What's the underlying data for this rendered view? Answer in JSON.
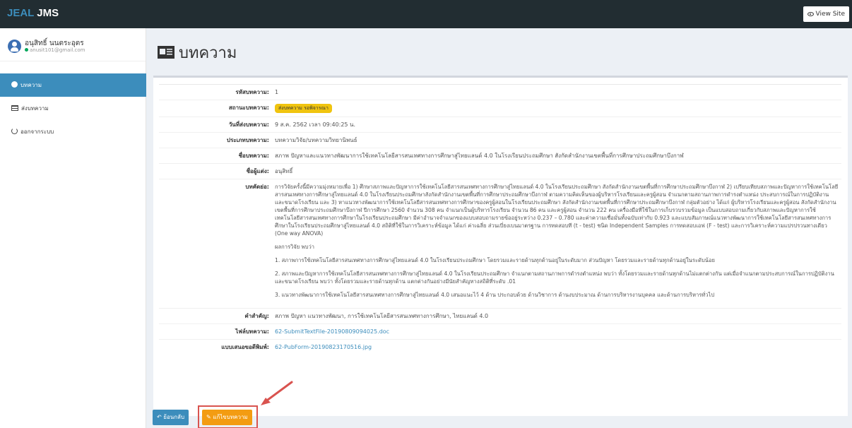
{
  "topbar": {
    "brand_accent": "JEAL",
    "brand_rest": " JMS",
    "view_site": "View Site"
  },
  "user": {
    "name": "อนุสิทธิ์ นนตระอุตร",
    "email": "anusit101@gmail.com"
  },
  "nav": {
    "items": [
      {
        "label": "บทความ",
        "active": true
      },
      {
        "label": "ส่งบทความ",
        "active": false
      },
      {
        "label": "ออกจากระบบ",
        "active": false
      }
    ]
  },
  "page": {
    "title": "บทความ"
  },
  "article": {
    "rows": [
      {
        "label": "รหัสบทความ:",
        "value": "1"
      },
      {
        "label": "สถานะบทความ:",
        "value": "ส่งบทความ รอพิจารณา"
      },
      {
        "label": "วันที่ส่งบทความ:",
        "value": "9 ส.ค. 2562 เวลา 09:40:25 น."
      },
      {
        "label": "ประเภทบทความ:",
        "value": "บทความวิจัย/บทความวิทยานิพนธ์"
      },
      {
        "label": "ชื่อบทความ:",
        "value": "สภาพ ปัญหาและแนวทางพัฒนาการใช้เทคโนโลยีสารสนเทศทางการศึกษาสู่ไทยแลนด์ 4.0 ในโรงเรียนประถมศึกษา สังกัดสำนักงานเขตพื้นที่การศึกษาประถมศึกษาบึงกาฬ"
      },
      {
        "label": "ชื่อผู้แต่ง:",
        "value": "อนุสิทธิ์"
      },
      {
        "label": "บทคัดย่อ:",
        "value": ""
      },
      {
        "label": "คำสำคัญ:",
        "value": "สภาพ ปัญหา แนวทางพัฒนา, การใช้เทคโนโลยีสารสนเทศทางการศึกษา, ไทยแลนด์ 4.0"
      },
      {
        "label": "ไฟล์บทความ:",
        "value": "62-SubmitTextFile-20190809094025.doc"
      },
      {
        "label": "แบบเสนอขอตีพิมพ์:",
        "value": "62-PubForm-20190823170516.jpg"
      }
    ],
    "abstract": [
      "การวิจัยครั้งนี้มีความมุ่งหมายเพื่อ 1) ศึกษาสภาพและปัญหาการใช้เทคโนโลยีสารสนเทศทางการศึกษาสู่ไทยแลนด์ 4.0 ในโรงเรียนประถมศึกษา สังกัดสำนักงานเขตพื้นที่การศึกษาประถมศึกษาบึงกาฬ 2) เปรียบเทียบสภาพและปัญหาการใช้เทคโนโลยีสารสนเทศทางการศึกษาสู่ไทยแลนด์ 4.0 ในโรงเรียนประถมศึกษาสังกัดสำนักงานเขตพื้นที่การศึกษาประถมศึกษาบึงกาฬ ตามความคิดเห็นของผู้บริหารโรงเรียนและครูผู้สอน จำแนกตามสถานภาพการดำรงตำแหน่ง ประสบการณ์ในการปฏิบัติงาน และขนาดโรงเรียน และ 3) หาแนวทางพัฒนาการใช้เทคโนโลยีสารสนเทศทางการศึกษาของครูผู้สอนในโรงเรียนประถมศึกษา สังกัดสำนักงานเขตพื้นที่การศึกษาประถมศึกษาบึงกาฬ กลุ่มตัวอย่าง ได้แก่ ผู้บริหารโรงเรียนและครูผู้สอน สังกัดสำนักงานเขตพื้นที่การศึกษาประถมศึกษาบึงกาฬ ปีการศึกษา 2560 จำนวน 308 คน จำแนกเป็นผู้บริหารโรงเรียน จำนวน 86 คน และครูผู้สอน จำนวน 222 คน เครื่องมือที่ใช้ในการเก็บรวบรวมข้อมูล เป็นแบบสอบถามเกี่ยวกับสภาพและปัญหาการใช้เทคโนโลยีสารสนเทศทางการศึกษาในโรงเรียนประถมศึกษา มีค่าอำนาจจำแนกของแบบสอบถามรายข้ออยู่ระหว่าง 0.237 – 0.780 และค่าความเชื่อมั่นทั้งฉบับเท่ากับ 0.923 และแบบสัมภาษณ์แนวทางพัฒนาการใช้เทคโนโลยีสารสนเทศทางการศึกษาในโรงเรียนประถมศึกษาสู่ไทยแลนด์ 4.0 สถิติที่ใช้ในการวิเคราะห์ข้อมูล ได้แก่ ค่าเฉลี่ย ส่วนเบี่ยงเบนมาตรฐาน การทดสอบที (t - test) ชนิด Independent Samples การทดสอบเอฟ (F - test) และการวิเคราะห์ความแปรปรวนทางเดียว (One way ANOVA)",
      "ผลการวิจัย พบว่า",
      "1. สภาพการใช้เทคโนโลยีสารสนเทศทางการศึกษาสู่ไทยแลนด์ 4.0 ในโรงเรียนประถมศึกษา โดยรวมและรายด้านทุกด้านอยู่ในระดับมาก ส่วนปัญหา โดยรวมและรายด้านทุกด้านอยู่ในระดับน้อย",
      "2. สภาพและปัญหาการใช้เทคโนโลยีสารสนเทศทางการศึกษาสู่ไทยแลนด์ 4.0 ในโรงเรียนประถมศึกษา จำแนกตามสถานภาพการดำรงตำแหน่ง พบว่า ทั้งโดยรวมและรายด้านทุกด้านไม่แตกต่างกัน แต่เมื่อจำแนกตามประสบการณ์ในการปฏิบัติงาน และขนาดโรงเรียน พบว่า ทั้งโดยรวมและรายด้านทุกด้าน แตกต่างกันอย่างมีนัยสำคัญทางสถิติที่ระดับ .01",
      "3. แนวทางพัฒนาการใช้เทคโนโลยีสารสนเทศทางการศึกษาสู่ไทยแลนด์ 4.0 เสนอแนะไว้ 4 ด้าน ประกอบด้วย ด้านวิชาการ ด้านงบประมาณ ด้านการบริหารงานบุคคล และด้านการบริหารทั่วไป"
    ]
  },
  "buttons": {
    "back": "ย้อนกลับ",
    "edit": "แก้ไขบทความ"
  },
  "colors": {
    "accent": "#3c8dbc",
    "warning": "#f39c12",
    "highlight": "#d9534f"
  }
}
